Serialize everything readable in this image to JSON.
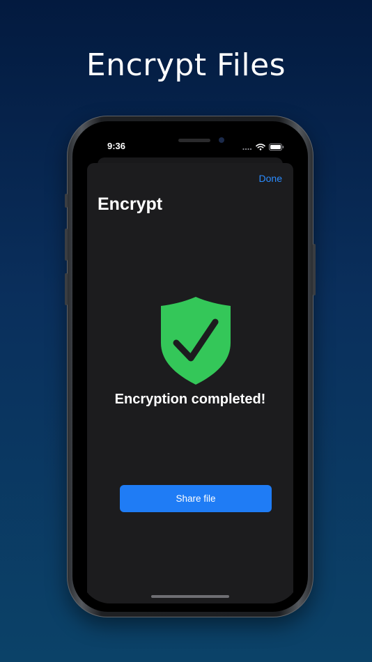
{
  "headline": "Encrypt Files",
  "status_bar": {
    "time": "9:36"
  },
  "sheet": {
    "done_label": "Done",
    "title": "Encrypt",
    "message": "Encryption completed!",
    "share_label": "Share file"
  },
  "colors": {
    "accent": "#2b8cff",
    "success": "#34c759",
    "sheet_background": "#1c1c1e"
  },
  "icons": {
    "shield": "shield-checkmark-icon",
    "wifi": "wifi-icon",
    "battery": "battery-icon"
  }
}
